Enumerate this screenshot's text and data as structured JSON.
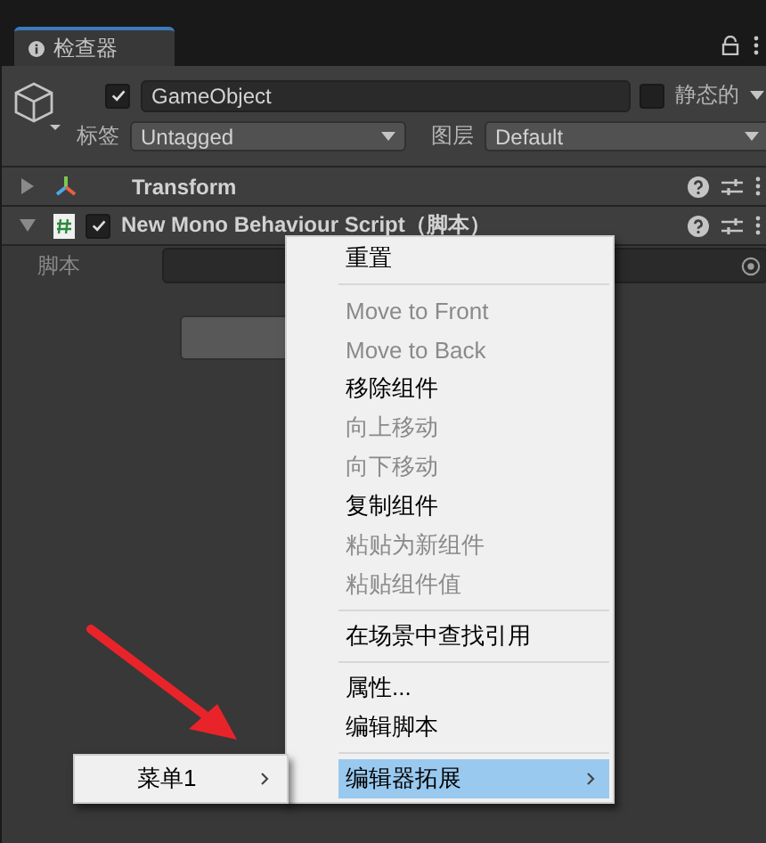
{
  "tab": {
    "label": "检查器"
  },
  "object": {
    "active": true,
    "name": "GameObject",
    "static_label": "静态的",
    "static": false,
    "tag_label": "标签",
    "tag": "Untagged",
    "layer_label": "图层",
    "layer": "Default"
  },
  "components": [
    {
      "kind": "transform",
      "name": "Transform",
      "expanded": false
    },
    {
      "kind": "script",
      "name": "New Mono Behaviour Script（脚本）",
      "expanded": true,
      "enabled": true
    }
  ],
  "script_field": {
    "label": "脚本"
  },
  "menu": {
    "items": [
      {
        "kind": "item",
        "label": "重置",
        "disabled": false,
        "selected": false,
        "submenu": false
      },
      {
        "kind": "separator"
      },
      {
        "kind": "item",
        "label": "Move to Front",
        "disabled": true,
        "selected": false,
        "submenu": false
      },
      {
        "kind": "item",
        "label": "Move to Back",
        "disabled": true,
        "selected": false,
        "submenu": false
      },
      {
        "kind": "item",
        "label": "移除组件",
        "disabled": false,
        "selected": false,
        "submenu": false
      },
      {
        "kind": "item",
        "label": "向上移动",
        "disabled": true,
        "selected": false,
        "submenu": false
      },
      {
        "kind": "item",
        "label": "向下移动",
        "disabled": true,
        "selected": false,
        "submenu": false
      },
      {
        "kind": "item",
        "label": "复制组件",
        "disabled": false,
        "selected": false,
        "submenu": false
      },
      {
        "kind": "item",
        "label": "粘贴为新组件",
        "disabled": true,
        "selected": false,
        "submenu": false
      },
      {
        "kind": "item",
        "label": "粘贴组件值",
        "disabled": true,
        "selected": false,
        "submenu": false
      },
      {
        "kind": "separator"
      },
      {
        "kind": "item",
        "label": "在场景中查找引用",
        "disabled": false,
        "selected": false,
        "submenu": false
      },
      {
        "kind": "separator"
      },
      {
        "kind": "item",
        "label": "属性...",
        "disabled": false,
        "selected": false,
        "submenu": false
      },
      {
        "kind": "item",
        "label": "编辑脚本",
        "disabled": false,
        "selected": false,
        "submenu": false
      },
      {
        "kind": "separator"
      },
      {
        "kind": "item",
        "label": "编辑器拓展",
        "disabled": false,
        "selected": true,
        "submenu": true
      }
    ]
  },
  "submenu": {
    "items": [
      {
        "label": "菜单1",
        "selected": false,
        "submenu": true
      }
    ]
  }
}
